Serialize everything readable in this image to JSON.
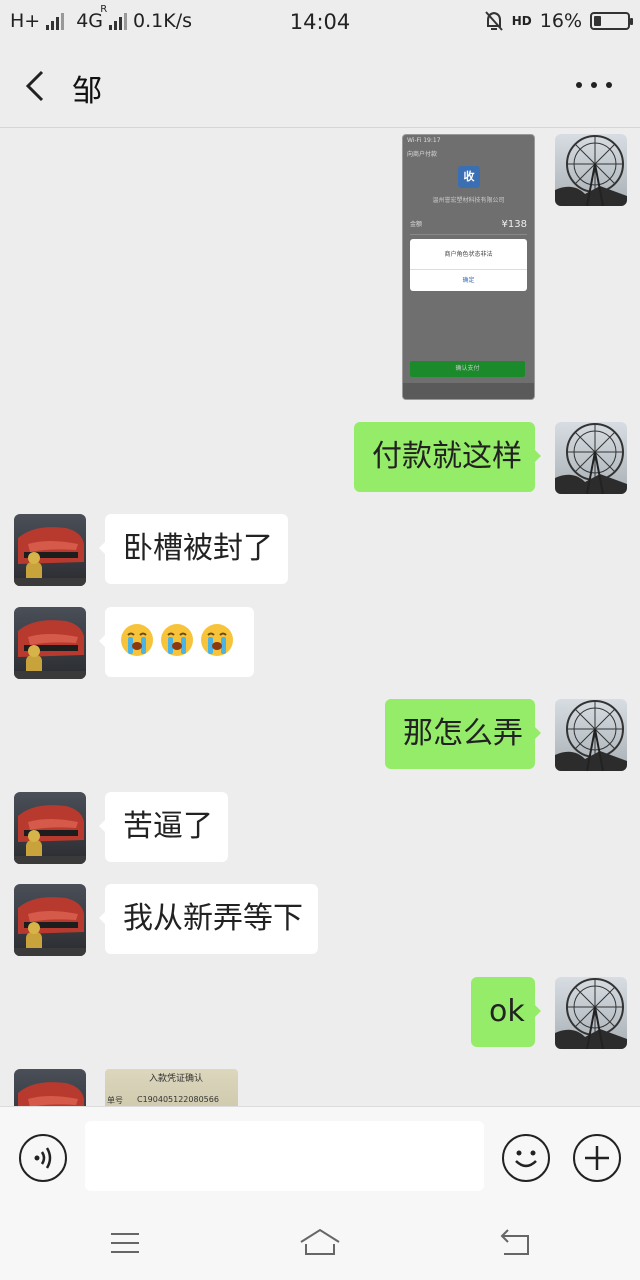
{
  "status_bar": {
    "network_left": "H+",
    "network_mid": "4G",
    "roaming_mark": "R",
    "speed": "0.1K/s",
    "time": "14:04",
    "hd_mark": "HD",
    "battery_percent": "16%",
    "battery_level": 0.16,
    "icons": [
      "signal-icon",
      "alarm-off-icon",
      "battery-icon"
    ]
  },
  "header": {
    "title": "邹",
    "back_icon": "back-arrow-icon",
    "menu_icon": "more-icon"
  },
  "messages": [
    {
      "side": "out",
      "type": "image",
      "image_content": {
        "status": "Wi-Fi 19:17",
        "header": "向商户付款",
        "logo": "收",
        "company": "温州誉宏塑材科技有限公司",
        "amount_label": "金额",
        "amount": "¥138",
        "dialog_message": "商户角色状态非法",
        "dialog_button": "确定",
        "pay_button": "确认支付"
      }
    },
    {
      "side": "out",
      "type": "text",
      "text": "付款就这样"
    },
    {
      "side": "in",
      "type": "text",
      "text": "卧槽被封了"
    },
    {
      "side": "in",
      "type": "emoji",
      "emoji_count": 3,
      "emoji_name": "crying-face-emoji"
    },
    {
      "side": "out",
      "type": "text",
      "text": "那怎么弄"
    },
    {
      "side": "in",
      "type": "text",
      "text": "苦逼了"
    },
    {
      "side": "in",
      "type": "text",
      "text": "我从新弄等下"
    },
    {
      "side": "out",
      "type": "text",
      "text": "ok"
    },
    {
      "side": "in",
      "type": "image",
      "image_content": {
        "title": "入款凭证确认",
        "label": "单号",
        "number": "C190405122080566"
      }
    }
  ],
  "input_bar": {
    "placeholder": "",
    "icons": [
      "voice-icon",
      "emoji-icon",
      "plus-icon"
    ]
  },
  "system_nav": {
    "icons": [
      "menu-icon",
      "home-icon",
      "return-icon"
    ]
  },
  "colors": {
    "background": "#ededed",
    "out_bubble": "#95ec69",
    "in_bubble": "#ffffff"
  }
}
